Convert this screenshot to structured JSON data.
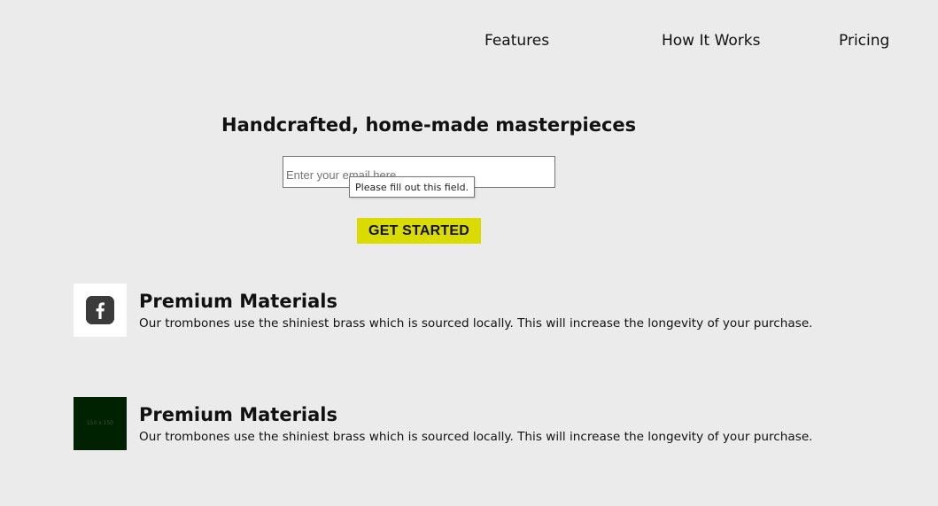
{
  "nav": {
    "items": [
      {
        "label": "Features"
      },
      {
        "label": "How It Works"
      },
      {
        "label": "Pricing"
      }
    ]
  },
  "hero": {
    "title": "Handcrafted, home-made masterpieces",
    "email_placeholder": "Enter your email here",
    "email_value": "",
    "validation_tooltip": "Please fill out this field.",
    "cta_label": "GET STARTED"
  },
  "features": [
    {
      "icon": "facebook-icon",
      "title": "Premium Materials",
      "description": "Our trombones use the shiniest brass which is sourced locally. This will increase the longevity of your purchase."
    },
    {
      "icon": "placeholder-image",
      "image_label": "150 x 150",
      "title": "Premium Materials",
      "description": "Our trombones use the shiniest brass which is sourced locally. This will increase the longevity of your purchase."
    }
  ],
  "colors": {
    "background": "#ebebeb",
    "cta": "#dadb00",
    "placeholder_image": "#002200"
  }
}
